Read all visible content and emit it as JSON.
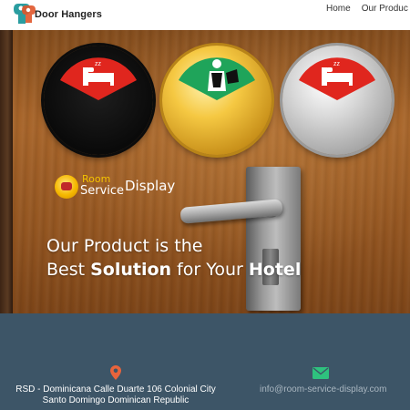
{
  "header": {
    "logo_text": "Door Hangers",
    "nav": [
      {
        "label": "Home"
      },
      {
        "label": "Our Produc"
      }
    ]
  },
  "hero": {
    "brand": {
      "room": "Room",
      "service": "Service",
      "display": "Display"
    },
    "tagline": {
      "line1": "Our Product is the",
      "line2_prefix": "Best ",
      "line2_bold1": "Solution",
      "line2_mid": " for Your ",
      "line2_bold2": "Hotel"
    },
    "dials": [
      {
        "finish": "black",
        "indicator": "do-not-disturb",
        "color": "#e0261e"
      },
      {
        "finish": "gold",
        "indicator": "make-up-room",
        "color": "#1fa45a"
      },
      {
        "finish": "silver",
        "indicator": "do-not-disturb",
        "color": "#e0261e"
      }
    ]
  },
  "contact": {
    "address_line1": "RSD - Dominicana Calle Duarte 106 Colonial City",
    "address_line2": "Santo Domingo Dominican Republic",
    "email": "info@room-service-display.com",
    "colors": {
      "background": "#3d5567",
      "icon_accent": "#e8643c",
      "mail_icon": "#2ec27e"
    }
  }
}
